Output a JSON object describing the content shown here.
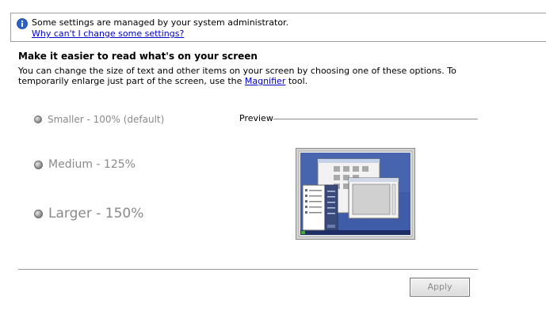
{
  "info_bar": {
    "message": "Some settings are managed by your system administrator.",
    "link": "Why can't I change some settings?"
  },
  "page": {
    "title": "Make it easier to read what's on your screen",
    "description_before": "You can change the size of text and other items on your screen by choosing one of these options. To temporarily enlarge just part of the screen, use the ",
    "description_link": "Magnifier",
    "description_after": " tool."
  },
  "options": [
    {
      "label": "Smaller - 100% (default)",
      "selected": true
    },
    {
      "label": "Medium - 125%",
      "selected": false
    },
    {
      "label": "Larger - 150%",
      "selected": false
    }
  ],
  "preview": {
    "label": "Preview"
  },
  "buttons": {
    "apply": "Apply"
  },
  "icons": {
    "info": "info-icon"
  }
}
